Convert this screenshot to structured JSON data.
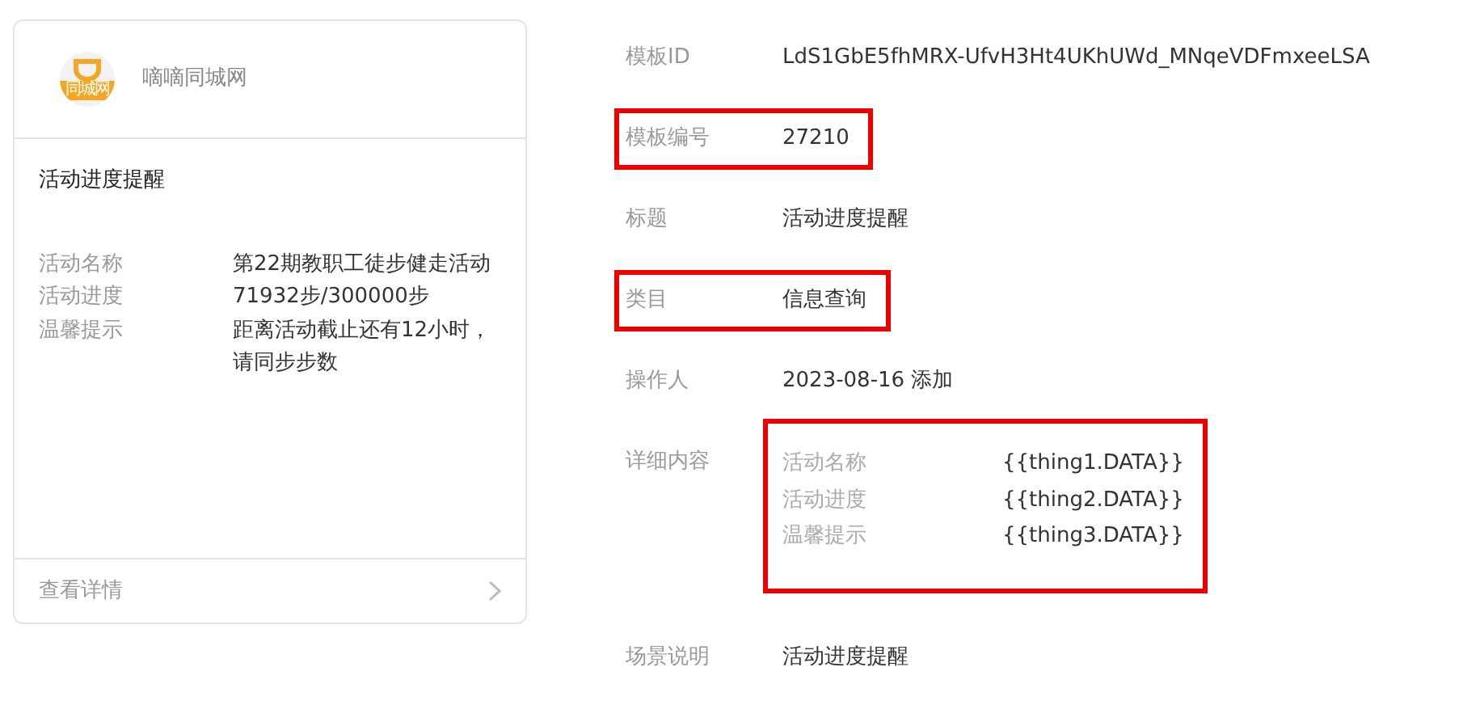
{
  "card": {
    "brand": "嘀嘀同城网",
    "logo_text": "同城网",
    "title": "活动进度提醒",
    "fields": [
      {
        "label": "活动名称",
        "value": "第22期教职工徒步健走活动"
      },
      {
        "label": "活动进度",
        "value": "71932步/300000步"
      },
      {
        "label": "温馨提示",
        "value": "距离活动截止还有12小时，请同步步数"
      }
    ],
    "footer": "查看详情"
  },
  "details": [
    {
      "kind": "text",
      "label": "模板ID",
      "value": "LdS1GbE5fhMRX-UfvH3Ht4UKhUWd_MNqeVDFmxeeLSA",
      "highlighted": false
    },
    {
      "kind": "text",
      "label": "模板编号",
      "value": "27210",
      "highlighted": true
    },
    {
      "kind": "text",
      "label": "标题",
      "value": "活动进度提醒",
      "highlighted": false
    },
    {
      "kind": "text",
      "label": "类目",
      "value": "信息查询",
      "highlighted": true
    },
    {
      "kind": "text",
      "label": "操作人",
      "value": "2023-08-16 添加",
      "highlighted": false
    },
    {
      "kind": "fields",
      "label": "详细内容",
      "highlighted": true,
      "fields": [
        {
          "label": "活动名称",
          "value": "{{thing1.DATA}}"
        },
        {
          "label": "活动进度",
          "value": "{{thing2.DATA}}"
        },
        {
          "label": "温馨提示",
          "value": "{{thing3.DATA}}"
        }
      ]
    },
    {
      "kind": "text",
      "label": "场景说明",
      "value": "活动进度提醒",
      "highlighted": false
    }
  ]
}
